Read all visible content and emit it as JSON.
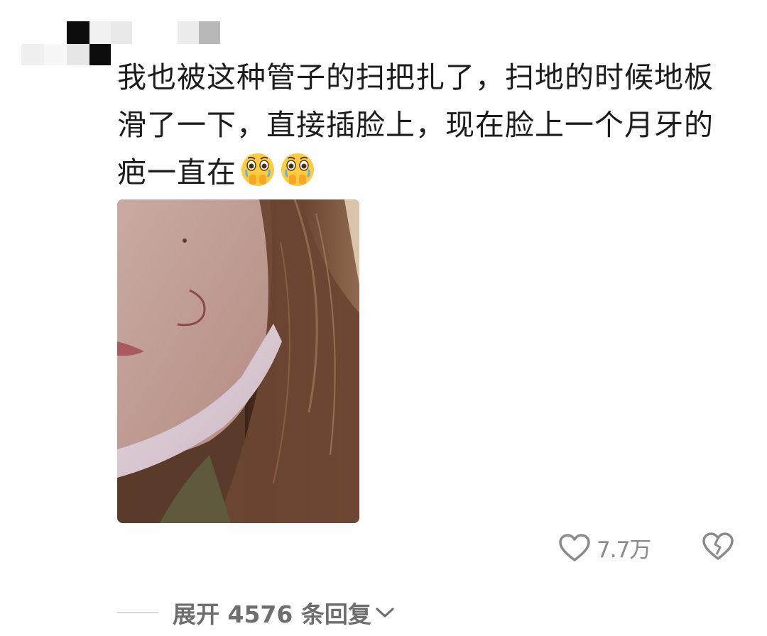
{
  "comment": {
    "text_line1": "我也被这种管子的扫把扎了，扫地的时候地板",
    "text_line2": "滑了一下，直接插脸上，现在脸上一个月牙的",
    "text_line3": "疤一直在",
    "emojis": [
      "crying-covering-mouth-emoji",
      "crying-covering-mouth-emoji"
    ]
  },
  "actions": {
    "like_count": "7.7万",
    "like_icon": "heart-outline-icon",
    "dislike_icon": "broken-heart-icon"
  },
  "replies": {
    "label": "展开 4576 条回复",
    "icon": "chevron-down-icon"
  },
  "colors": {
    "text": "#1c1c1c",
    "muted": "#8a8a8a",
    "reply_text": "#6e6e6e",
    "background": "#fefefe"
  }
}
